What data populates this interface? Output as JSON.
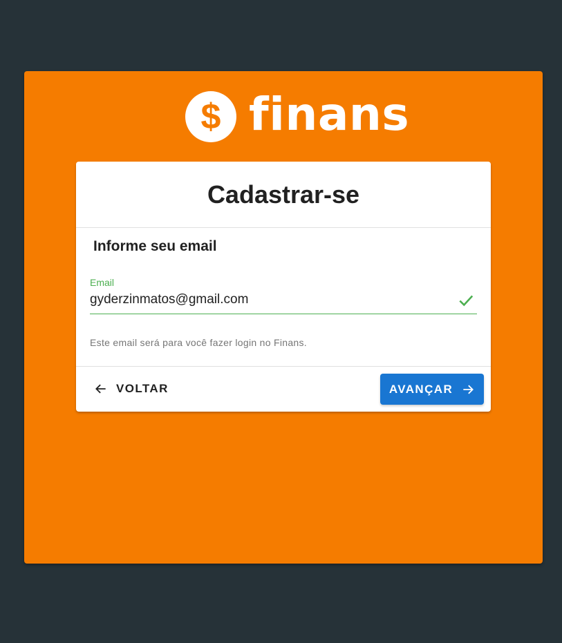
{
  "brand": {
    "logo_symbol": "$",
    "name": "finans",
    "colors": {
      "background": "#263238",
      "panel": "#f57c00",
      "primary_button": "#1976d2",
      "valid_field": "#4caf50"
    }
  },
  "card": {
    "title": "Cadastrar-se",
    "section_heading": "Informe seu email",
    "email_field": {
      "label": "Email",
      "value": "gyderzinmatos@gmail.com",
      "status_icon": "check-icon"
    },
    "hint": "Este email será para você fazer login no Finans.",
    "actions": {
      "back_label": "VOLTAR",
      "back_icon": "arrow-left-icon",
      "next_label": "AVANÇAR",
      "next_icon": "arrow-right-icon"
    }
  }
}
